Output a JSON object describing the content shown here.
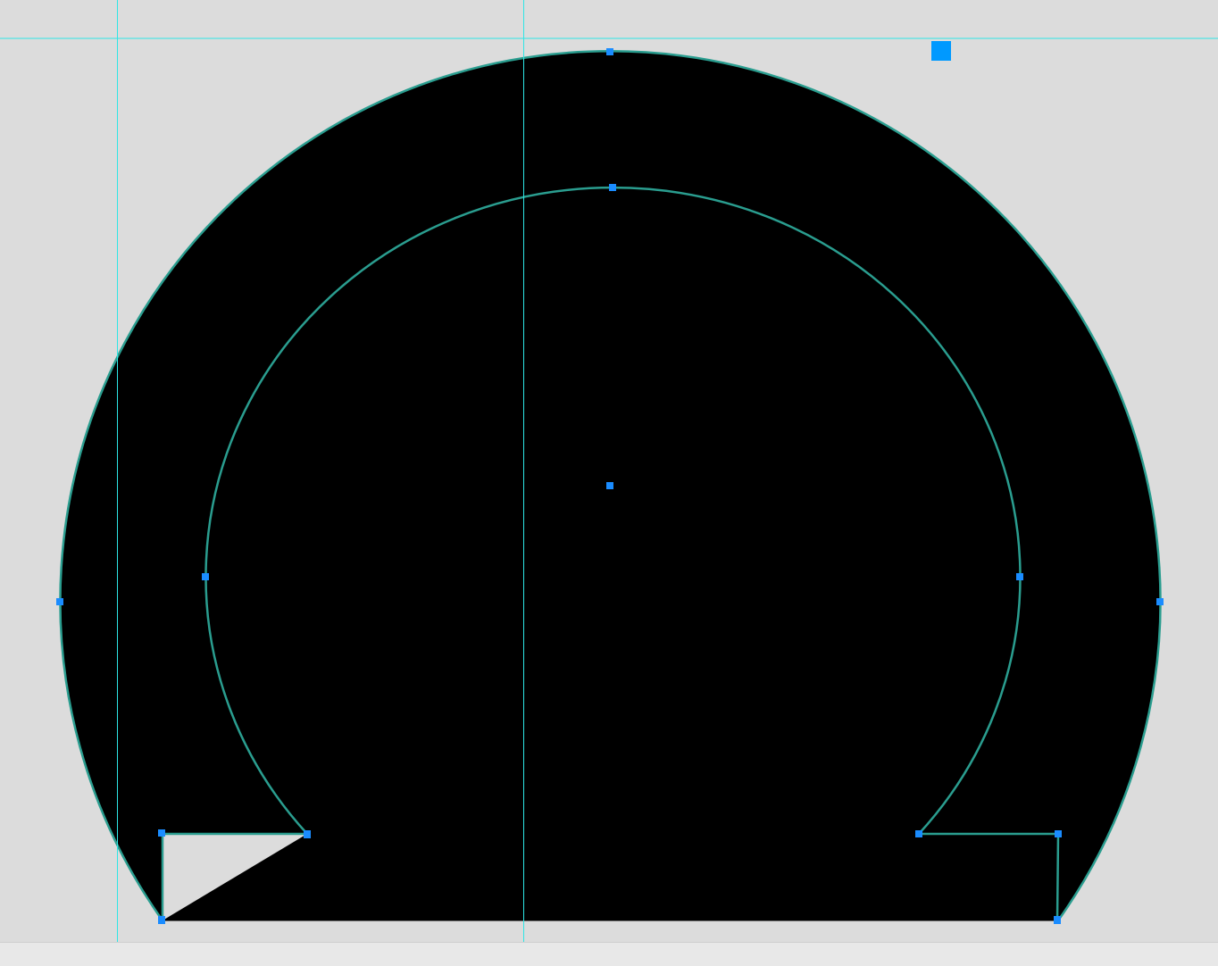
{
  "colors": {
    "canvas_background": "#dcdcdc",
    "shape_fill": "#000000",
    "path_outline": "#2a9d8f",
    "guide_line": "#2ee6e6",
    "anchor_point": "#1a8cff",
    "selection_widget": "#0099ff",
    "statusbar_background": "#e8e8e8"
  },
  "icons": {
    "anchor": "square-anchor-handle",
    "selection_widget": "square-widget"
  },
  "statusbar": {
    "text": ""
  }
}
